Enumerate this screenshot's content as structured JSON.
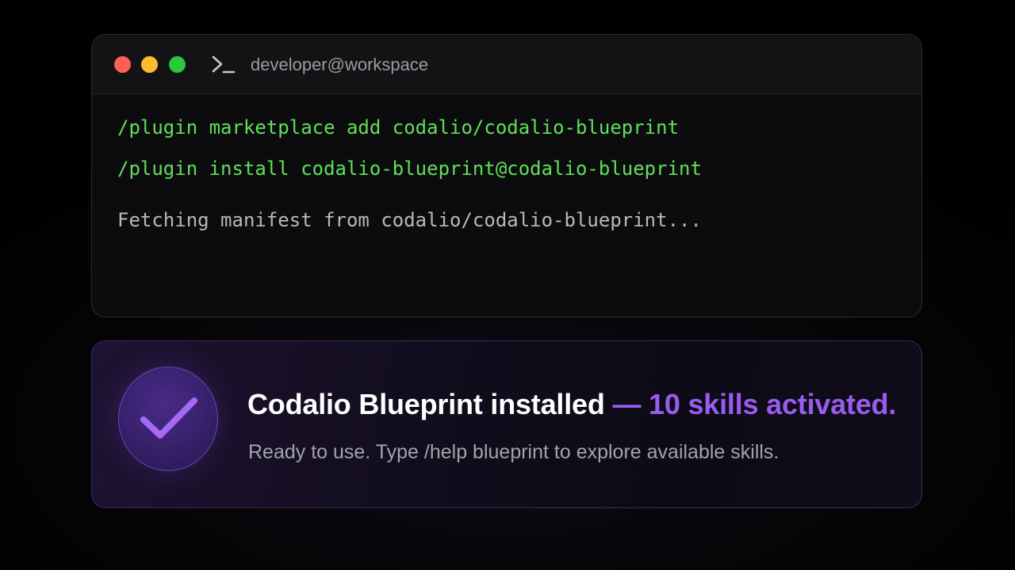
{
  "colors": {
    "red_dot": "#ff5f57",
    "yellow_dot": "#febc2e",
    "green_dot": "#28c840",
    "command_text": "#5fe05a",
    "output_text": "#b9b9bd",
    "headline_text": "#ffffff",
    "headline_accent": "#9a5cf0",
    "subtext": "#a3a3ab",
    "check_mark": "#a46af7"
  },
  "terminal": {
    "title_icon": "terminal-prompt-icon",
    "title": "developer@workspace",
    "lines": [
      {
        "kind": "command",
        "text": "/plugin marketplace add codalio/codalio-blueprint"
      },
      {
        "kind": "command",
        "text": "/plugin install codalio-blueprint@codalio-blueprint"
      },
      {
        "kind": "output",
        "text": "Fetching manifest from codalio/codalio-blueprint..."
      }
    ]
  },
  "success_card": {
    "icon": "checkmark-icon",
    "headline_main": "Codalio Blueprint installed ",
    "headline_accent": "— 10 skills activated.",
    "subtext": "Ready to use. Type /help blueprint to explore available skills."
  }
}
